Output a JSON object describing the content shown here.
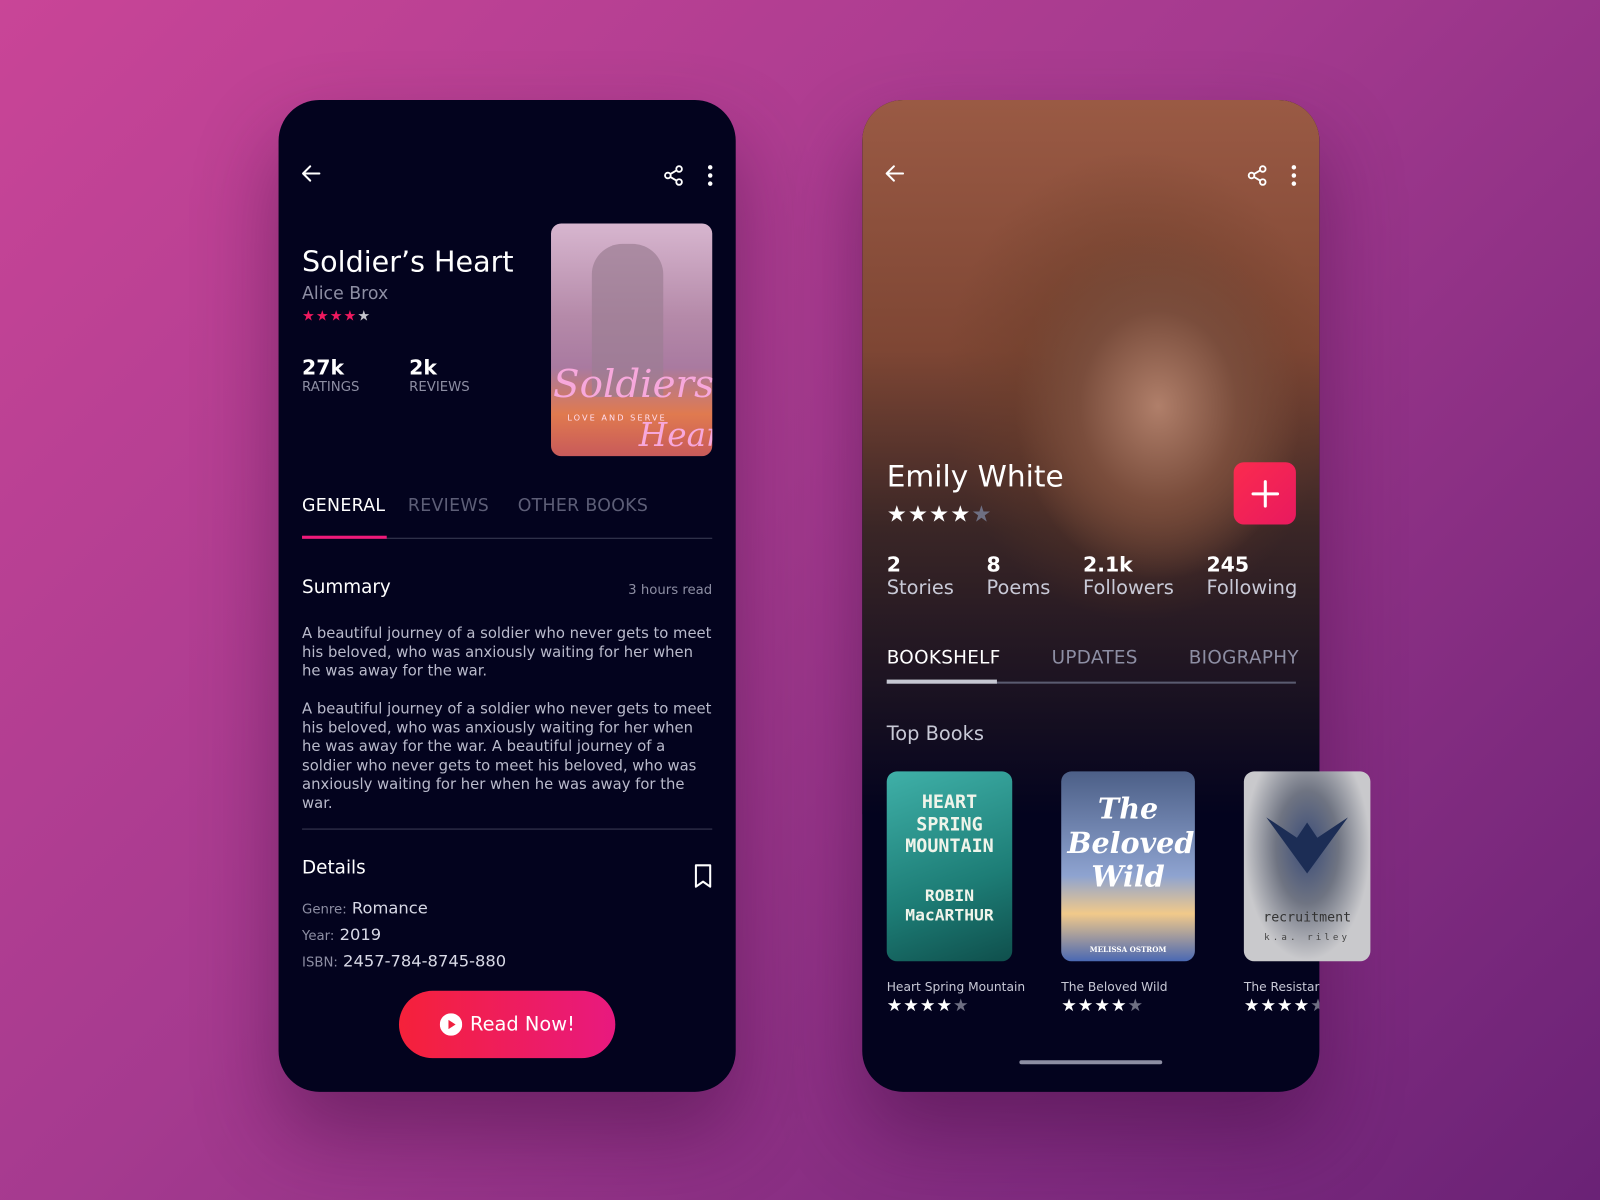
{
  "book_screen": {
    "title": "Soldier’s Heart",
    "author": "Alice Brox",
    "rating": 4,
    "rating_max": 5,
    "stats": [
      {
        "value": "27k",
        "label": "RATINGS"
      },
      {
        "value": "2k",
        "label": "REVIEWS"
      }
    ],
    "cover": {
      "title_line1": "Soldiers",
      "title_line2": "Heart",
      "tagline": "LOVE AND SERVE"
    },
    "tabs": [
      "GENERAL",
      "REVIEWS",
      "OTHER BOOKS"
    ],
    "active_tab": 0,
    "summary": {
      "heading": "Summary",
      "read_time": "3 hours read",
      "paragraphs": [
        "A beautiful journey of a soldier who never gets to meet his beloved, who was anxiously waiting for her when he was away for the war.",
        "A beautiful journey of a soldier who never gets to meet his beloved, who was anxiously waiting for her when he was away for the war. A beautiful journey of a soldier who never gets to meet his beloved, who was anxiously waiting for her when he was away for the war."
      ]
    },
    "details": {
      "heading": "Details",
      "genre_label": "Genre:",
      "genre": "Romance",
      "year_label": "Year:",
      "year": "2019",
      "isbn_label": "ISBN:",
      "isbn": "2457-784-8745-880"
    },
    "read_button": "Read Now!",
    "accent": "#f0195f"
  },
  "profile_screen": {
    "name": "Emily White",
    "rating": 4,
    "stats": [
      {
        "value": "2",
        "label": "Stories"
      },
      {
        "value": "8",
        "label": "Poems"
      },
      {
        "value": "2.1k",
        "label": "Followers"
      },
      {
        "value": "245",
        "label": "Following"
      }
    ],
    "tabs": [
      "BOOKSHELF",
      "UPDATES",
      "BIOGRAPHY"
    ],
    "active_tab": 0,
    "section_title": "Top Books",
    "books": [
      {
        "title": "Heart Spring Mountain",
        "rating": 4,
        "cover_text": "HEART SPRING MOUNTAIN",
        "cover_author": "ROBIN MacARTHUR"
      },
      {
        "title": "The Beloved Wild",
        "rating": 4,
        "cover_text": "The Beloved Wild",
        "cover_author": "MELISSA OSTROM"
      },
      {
        "title": "The Resistan",
        "rating": 4,
        "cover_text": "recruitment",
        "cover_author": "k.a. riley"
      }
    ]
  },
  "icons": [
    "back-arrow-icon",
    "share-icon",
    "more-vertical-icon",
    "bookmark-icon",
    "play-icon",
    "plus-icon",
    "star-icon"
  ]
}
